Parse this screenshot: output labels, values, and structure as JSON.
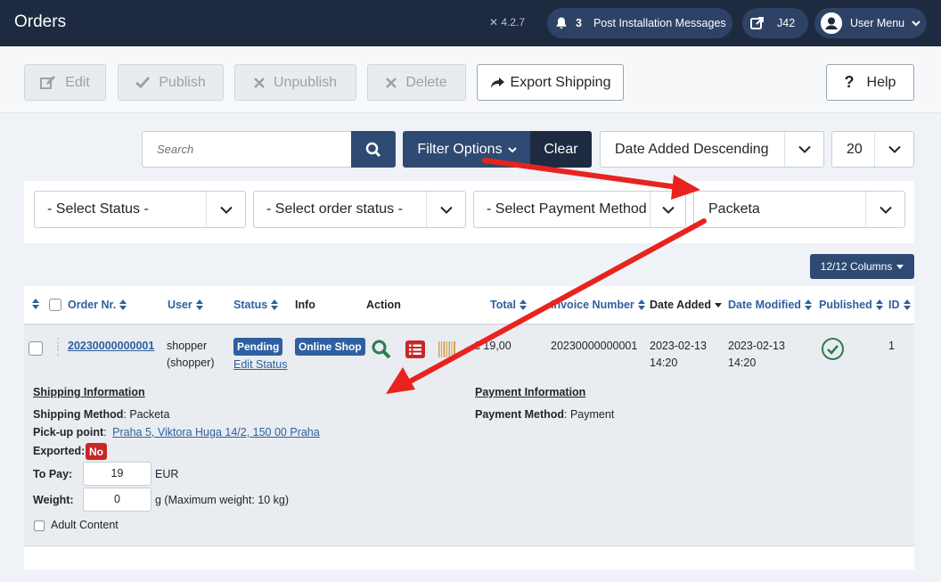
{
  "header": {
    "title": "Orders",
    "version": "4.2.7",
    "notification_count": "3",
    "post_install_label": "Post Installation Messages",
    "site_label": "J42",
    "user_menu_label": "User Menu"
  },
  "toolbar": {
    "edit": "Edit",
    "publish": "Publish",
    "unpublish": "Unpublish",
    "delete": "Delete",
    "export_shipping": "Export Shipping",
    "help": "Help"
  },
  "filters": {
    "search_placeholder": "Search",
    "filter_options": "Filter Options",
    "clear": "Clear",
    "sort": "Date Added Descending",
    "limit": "20",
    "status": "- Select Status -",
    "order_status": "- Select order status -",
    "payment_method": "- Select Payment Method -",
    "shipping": "Packeta"
  },
  "columns_button": "12/12 Columns",
  "table": {
    "headers": {
      "order_nr": "Order Nr.",
      "user": "User",
      "status": "Status",
      "info": "Info",
      "action": "Action",
      "total": "Total",
      "invoice_number": "Invoice Number",
      "date_added": "Date Added",
      "date_modified": "Date Modified",
      "published": "Published",
      "id": "ID"
    },
    "row": {
      "order_nr": "20230000000001",
      "user_line1": "shopper",
      "user_line2": "(shopper)",
      "status": "Pending",
      "edit_status": "Edit Status",
      "info": "Online Shop",
      "total": "€ 19,00",
      "invoice_number": "20230000000001",
      "date_added_date": "2023-02-13",
      "date_added_time": "14:20",
      "date_modified_date": "2023-02-13",
      "date_modified_time": "14:20",
      "id": "1"
    }
  },
  "details": {
    "shipping_heading": "Shipping Information",
    "shipping_method_label": "Shipping Method",
    "shipping_method_value": ": Packeta",
    "pickup_label": "Pick-up point",
    "pickup_colon": ":",
    "pickup_value": "Praha 5, Viktora Huga 14/2, 150 00 Praha",
    "exported_label": "Exported:",
    "exported_value": "No",
    "to_pay_label": "To Pay:",
    "to_pay_value": "19",
    "to_pay_unit": "EUR",
    "weight_label": "Weight:",
    "weight_value": "0",
    "weight_unit": "g (Maximum weight: 10 kg)",
    "adult_content": "Adult Content",
    "payment_heading": "Payment Information",
    "payment_method_label": "Payment Method",
    "payment_method_value": ": Payment"
  },
  "colors": {
    "header_bg": "#1d2a3f",
    "primary": "#2f4a72",
    "link": "#2f5fa0",
    "danger": "#c52827",
    "success": "#2e7d4f",
    "annotation_arrow": "#e8231f"
  }
}
